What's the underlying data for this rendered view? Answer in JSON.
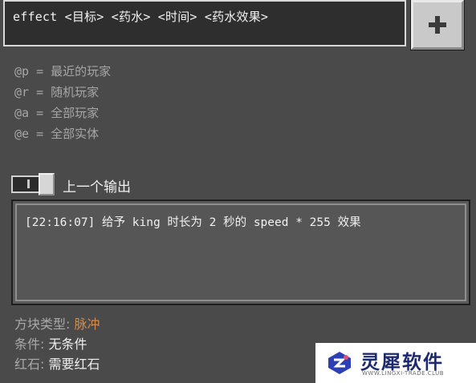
{
  "command": {
    "text": "effect <目标> <药水> <时间> <药水效果>"
  },
  "add_button": {
    "icon": "plus-icon"
  },
  "legend": [
    {
      "text": "@p = 最近的玩家"
    },
    {
      "text": "@r = 随机玩家"
    },
    {
      "text": "@a = 全部玩家"
    },
    {
      "text": "@e = 全部实体"
    }
  ],
  "previous_output": {
    "toggle_state": "off",
    "label": "上一个输出",
    "log": "[22:16:07] 给予 king 时长为 2 秒的 speed * 255 效果"
  },
  "block_info": {
    "type_key": "方块类型:",
    "type_value": "脉冲",
    "condition_key": "条件:",
    "condition_value": "无条件",
    "redstone_key": "红石:",
    "redstone_value": "需要红石"
  },
  "colors": {
    "background": "#4a4a4a",
    "pulse_accent": "#d38a4a"
  },
  "watermark": {
    "title": "灵犀软件",
    "subtitle": "WWW.LINGXI-TRADE.CLUB"
  }
}
